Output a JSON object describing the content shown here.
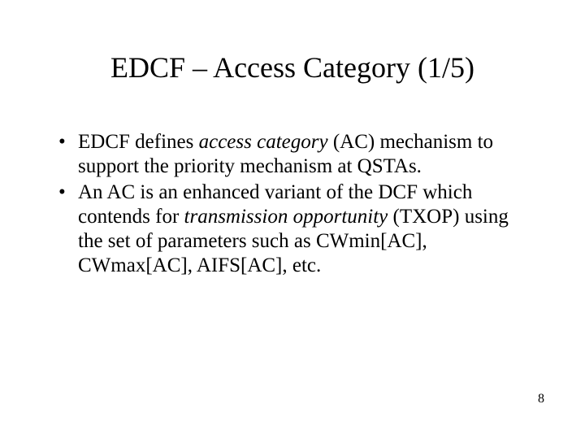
{
  "slide": {
    "title": "EDCF – Access Category (1/5)",
    "bullets": [
      {
        "pre": "EDCF defines ",
        "em1": "access category",
        "post1": " (AC) mechanism to support the priority mechanism at QSTAs."
      },
      {
        "pre": "An AC is an enhanced variant of the DCF which contends for ",
        "em1": "transmission opportunity",
        "post1": " (TXOP) using the set of parameters such as CWmin[AC], CWmax[AC], AIFS[AC], etc."
      }
    ],
    "page_number": "8",
    "bullet_char": "•"
  }
}
